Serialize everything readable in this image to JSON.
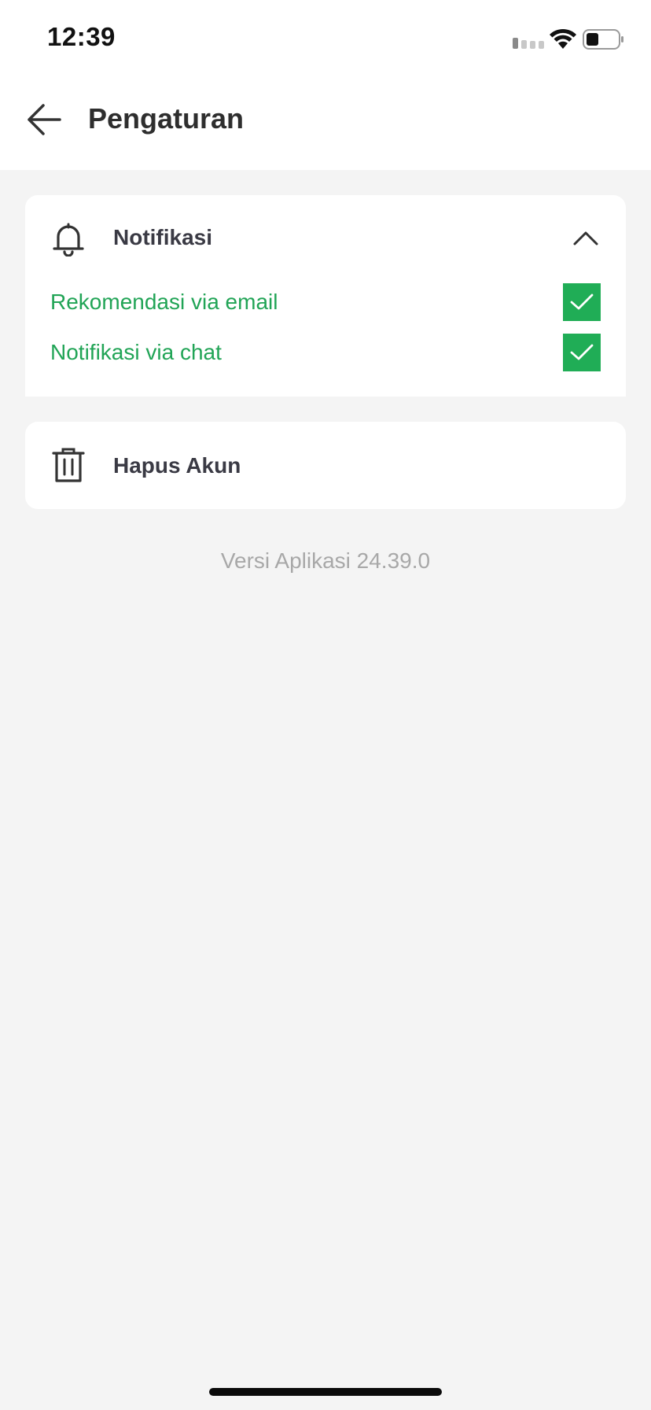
{
  "status_bar": {
    "time": "12:39",
    "signal_icon": "signal-icon",
    "wifi_icon": "wifi-icon",
    "battery_icon": "battery-icon"
  },
  "header": {
    "back_icon": "arrow-left-icon",
    "title": "Pengaturan"
  },
  "notifications": {
    "icon": "bell-icon",
    "title": "Notifikasi",
    "toggle_icon": "chevron-up-icon",
    "expanded": true,
    "options": [
      {
        "label": "Rekomendasi via email",
        "checked": true
      },
      {
        "label": "Notifikasi via chat",
        "checked": true
      }
    ]
  },
  "delete_account": {
    "icon": "trash-icon",
    "label": "Hapus Akun"
  },
  "version": "Versi Aplikasi 24.39.0",
  "colors": {
    "accent_green": "#20ad56",
    "label_green": "#21a456",
    "text_dark": "#3a3a44",
    "background": "#f4f4f4"
  }
}
